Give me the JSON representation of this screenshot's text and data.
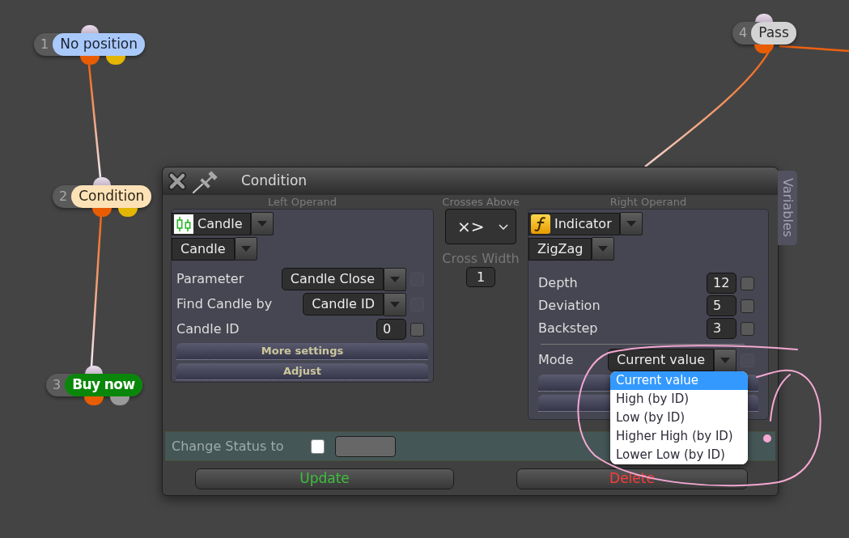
{
  "canvas": {
    "nodes": [
      {
        "number": "1",
        "label": "No position",
        "kind": "status",
        "color": "#a9c9fb",
        "outputs": [
          {
            "color": "#e85d04"
          },
          {
            "color": "#e3b505"
          }
        ]
      },
      {
        "number": "2",
        "label": "Condition",
        "kind": "condition",
        "color": "#fde2b7",
        "outputs": [
          {
            "color": "#e85d04"
          },
          {
            "color": "#e3b505"
          }
        ]
      },
      {
        "number": "3",
        "label": "Buy now",
        "kind": "action",
        "color": "#0a870a",
        "outputs": [
          {
            "color": "#e85d04"
          },
          {
            "color": "#9a9a9a"
          }
        ]
      },
      {
        "number": "4",
        "label": "Pass",
        "kind": "pass",
        "color": "#d3d3d3",
        "outputs": [
          {
            "color": "#e85d04"
          }
        ]
      }
    ]
  },
  "dialog": {
    "title": "Condition",
    "side_tab": "Variables",
    "left_operand": {
      "heading": "Left Operand",
      "source": {
        "kind": "candle",
        "value": "Candle"
      },
      "subtype": {
        "value": "Candle"
      },
      "fields": [
        {
          "kind": "select",
          "label": "Parameter",
          "value": "Candle Close",
          "checkbox": {
            "checked": false,
            "disabled": true
          }
        },
        {
          "kind": "select",
          "label": "Find Candle by",
          "value": "Candle ID",
          "checkbox": {
            "checked": false,
            "disabled": true
          }
        },
        {
          "kind": "number",
          "label": "Candle ID",
          "value": "0",
          "checkbox": {
            "checked": false,
            "disabled": false
          }
        }
      ],
      "buttons": [
        "More settings",
        "Adjust"
      ]
    },
    "operator": {
      "heading": "Crosses Above",
      "symbol": "×>",
      "width_label": "Cross Width",
      "width_value": "1"
    },
    "right_operand": {
      "heading": "Right Operand",
      "source": {
        "kind": "indicator",
        "value": "Indicator"
      },
      "subtype": {
        "value": "ZigZag"
      },
      "fields": [
        {
          "kind": "number",
          "label": "Depth",
          "value": "12",
          "checkbox": {
            "checked": false,
            "disabled": false
          }
        },
        {
          "kind": "number",
          "label": "Deviation",
          "value": "5",
          "checkbox": {
            "checked": false,
            "disabled": false
          }
        },
        {
          "kind": "number",
          "label": "Backstep",
          "value": "3",
          "checkbox": {
            "checked": false,
            "disabled": false
          }
        },
        {
          "kind": "select",
          "label": "Mode",
          "value": "Current value",
          "separator_before": true,
          "checkbox": {
            "checked": false,
            "disabled": true
          },
          "open": true,
          "options": [
            {
              "label": "Current value",
              "selected": true
            },
            {
              "label": "High (by ID)",
              "selected": false
            },
            {
              "label": "Low (by ID)",
              "selected": false
            },
            {
              "label": "Higher High (by ID)",
              "selected": false
            },
            {
              "label": "Lower Low (by ID)",
              "selected": false
            }
          ]
        }
      ]
    },
    "change_status": {
      "label": "Change Status to",
      "checked": false
    },
    "actions": [
      {
        "kind": "update",
        "label": "Update"
      },
      {
        "kind": "delete",
        "label": "Delete"
      }
    ]
  }
}
